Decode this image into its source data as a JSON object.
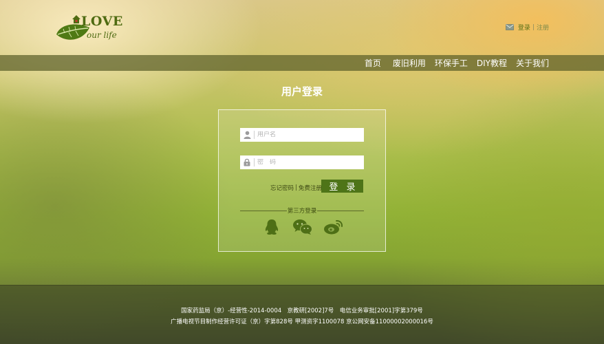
{
  "logo": {
    "title": "LOVE",
    "subtitle": "our life"
  },
  "top_links": {
    "login": "登录",
    "separator": "|",
    "register": "注册",
    "icon": "mail-icon"
  },
  "nav": {
    "items": [
      "首页",
      "废旧利用",
      "环保手工",
      "DIY教程",
      "关于我们"
    ]
  },
  "page_title": "用户登录",
  "login_form": {
    "username_placeholder": "用户名",
    "password_placeholder": "密　码",
    "forgot_password": "忘记密码",
    "link_separator": "|",
    "free_register": "免费注册",
    "submit_label": "登 录",
    "third_party_label": "第三方登录",
    "social_icons": [
      "qq-icon",
      "wechat-icon",
      "weibo-icon"
    ]
  },
  "footer": {
    "line1": "国家药监局（京）-经营性-2014-0004　京教研[2002]7号　电信业务审批[2001]字第379号",
    "line2": "广播电视节目制作经营许可证（京）字第828号 甲测资字1100078 京公网安备11000002000016号"
  },
  "colors": {
    "brand_green": "#4e7418",
    "navbar": "#5c602a",
    "text_dark": "#3e4a14"
  }
}
